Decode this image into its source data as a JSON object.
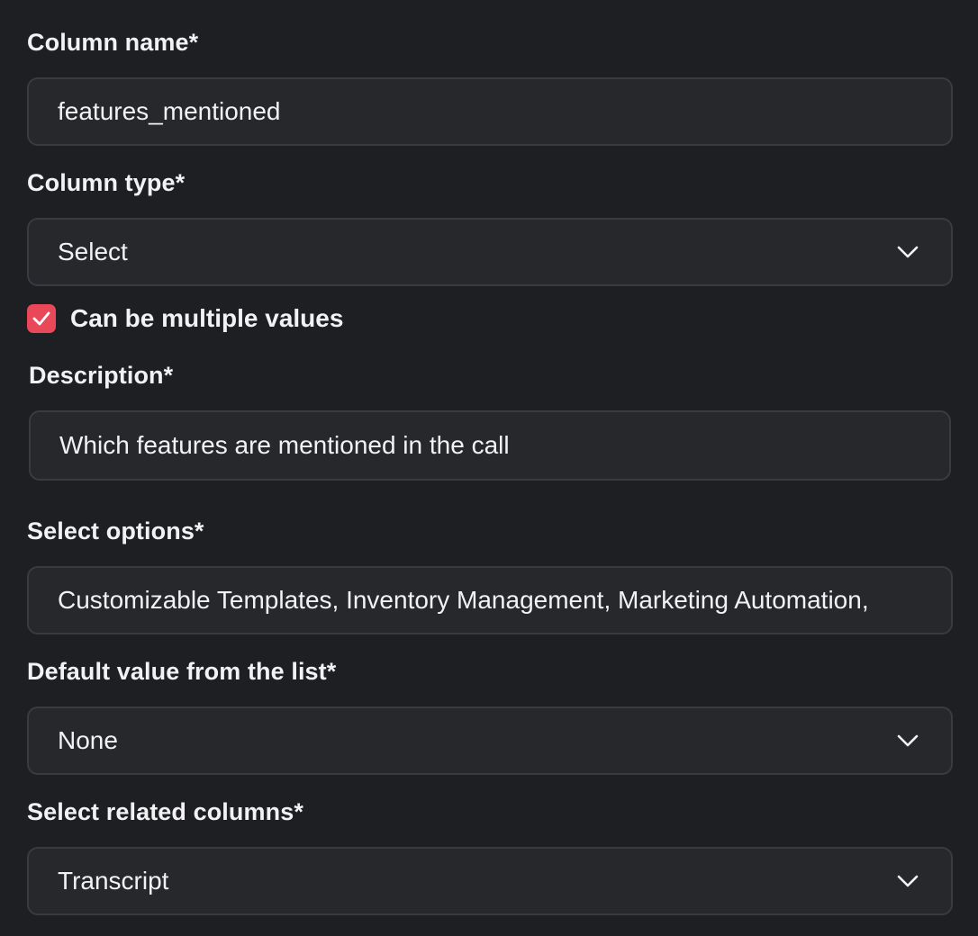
{
  "column_name": {
    "label": "Column name*",
    "value": "features_mentioned"
  },
  "column_type": {
    "label": "Column type*",
    "value": "Select"
  },
  "multiple_values": {
    "label": "Can be multiple values",
    "checked": true
  },
  "description": {
    "label": "Description*",
    "value": "Which features are mentioned in the call"
  },
  "select_options": {
    "label": "Select options*",
    "value": "Customizable Templates, Inventory Management, Marketing Automation,"
  },
  "default_value": {
    "label": "Default value from the list*",
    "value": "None"
  },
  "related_columns": {
    "label": "Select related columns*",
    "value": "Transcript"
  },
  "colors": {
    "background": "#1e1f22",
    "field_background": "#27282c",
    "field_border": "#3a3b40",
    "checkbox_accent": "#e84857",
    "text": "#f2f2f4"
  },
  "icons": {
    "dropdown": "chevron-down-icon",
    "checkbox": "checkmark-icon"
  }
}
